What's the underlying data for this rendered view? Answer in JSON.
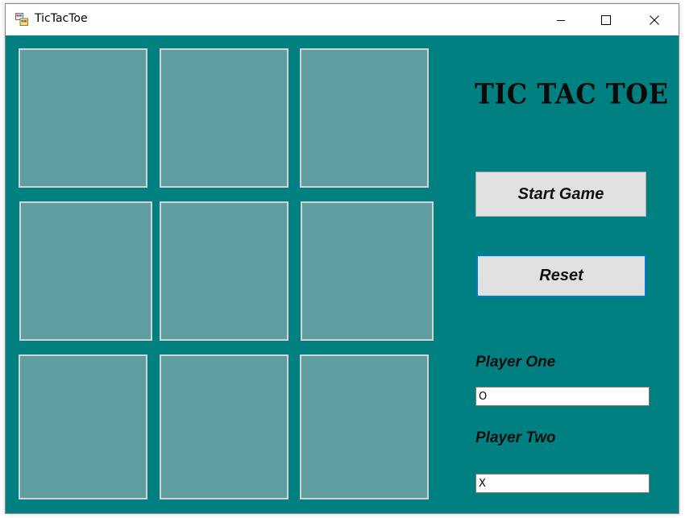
{
  "window": {
    "title": "TicTacToe",
    "app_icon": "winforms-app-icon",
    "controls": {
      "minimize_icon": "minimize-icon",
      "maximize_icon": "maximize-icon",
      "close_icon": "close-icon"
    }
  },
  "colors": {
    "form_background": "#008080",
    "cell_background": "#5F9EA0",
    "cell_border": "#D3D3D3",
    "button_background": "#E1E1E1",
    "focus_border": "#0078D7"
  },
  "board": {
    "cells": [
      "",
      "",
      "",
      "",
      "",
      "",
      "",
      "",
      ""
    ]
  },
  "heading": "TIC TAC TOE",
  "buttons": {
    "start_label": "Start Game",
    "reset_label": "Reset"
  },
  "players": {
    "one_label": "Player One",
    "one_value": "O",
    "two_label": "Player Two",
    "two_value": "X"
  }
}
